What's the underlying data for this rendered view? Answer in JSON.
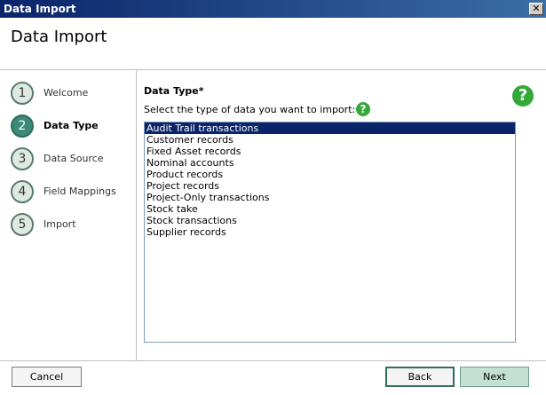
{
  "window": {
    "title": "Data Import",
    "close_glyph": "✕"
  },
  "header": {
    "title": "Data Import"
  },
  "steps": [
    {
      "number": "1",
      "label": "Welcome"
    },
    {
      "number": "2",
      "label": "Data Type"
    },
    {
      "number": "3",
      "label": "Data Source"
    },
    {
      "number": "4",
      "label": "Field Mappings"
    },
    {
      "number": "5",
      "label": "Import"
    }
  ],
  "content": {
    "section_title": "Data Type*",
    "instruction": "Select the type of data you want to import:",
    "help_glyph": "?",
    "list_items": [
      "Audit Trail transactions",
      "Customer records",
      "Fixed Asset records",
      "Nominal accounts",
      "Product records",
      "Project records",
      "Project-Only transactions",
      "Stock take",
      "Stock transactions",
      "Supplier records"
    ],
    "selected_item": "Audit Trail transactions"
  },
  "footer": {
    "cancel_label": "Cancel",
    "back_label": "Back",
    "next_label": "Next"
  },
  "colors": {
    "titlebar": "#0a246a",
    "active_step": "#3d8a78",
    "help_icon": "#35a83a",
    "selection": "#0a246a",
    "next_button": "#c4e0d2"
  }
}
